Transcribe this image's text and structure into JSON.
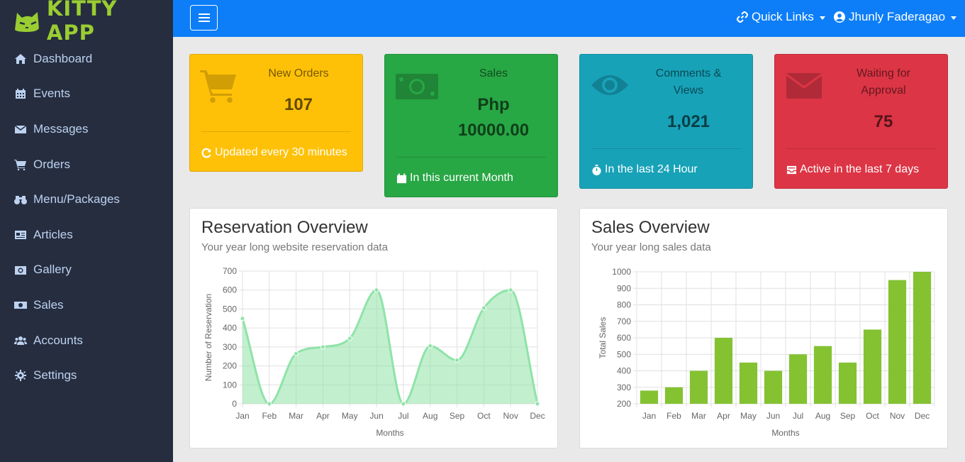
{
  "brand": {
    "name": "KITTY APP"
  },
  "sidebar": {
    "items": [
      {
        "label": "Dashboard",
        "icon": "home-icon"
      },
      {
        "label": "Events",
        "icon": "calendar-icon"
      },
      {
        "label": "Messages",
        "icon": "envelope-icon"
      },
      {
        "label": "Orders",
        "icon": "cart-icon"
      },
      {
        "label": "Menu/Packages",
        "icon": "binoculars-icon"
      },
      {
        "label": "Articles",
        "icon": "newspaper-icon"
      },
      {
        "label": "Gallery",
        "icon": "camera-icon"
      },
      {
        "label": "Sales",
        "icon": "money-bill-icon"
      },
      {
        "label": "Accounts",
        "icon": "users-icon"
      },
      {
        "label": "Settings",
        "icon": "gear-icon"
      }
    ]
  },
  "topbar": {
    "quick_links": "Quick Links",
    "user_name": "Jhunly Faderagao"
  },
  "cards": {
    "orders": {
      "label": "New Orders",
      "value": "107",
      "footer": "Updated every 30 minutes",
      "color": "#ffc107"
    },
    "sales": {
      "label": "Sales",
      "value_line1": "Php",
      "value_line2": "10000.00",
      "footer": "In this current Month",
      "color": "#28a745"
    },
    "comments": {
      "label_line1": "Comments &",
      "label_line2": "Views",
      "value": "1,021",
      "footer": "In the last 24 Hour",
      "color": "#17a2b8"
    },
    "approval": {
      "label_line1": "Waiting for",
      "label_line2": "Approval",
      "value": "75",
      "footer": "Active in the last 7 days",
      "color": "#dc3545"
    }
  },
  "reservation_panel": {
    "title": "Reservation Overview",
    "subtitle": "Your year long website reservation data"
  },
  "sales_panel": {
    "title": "Sales Overview",
    "subtitle": "Your year long sales data"
  },
  "chart_data": [
    {
      "type": "area",
      "categories": [
        "Jan",
        "Feb",
        "Mar",
        "Apr",
        "May",
        "Jun",
        "Jul",
        "Aug",
        "Sep",
        "Oct",
        "Nov",
        "Dec"
      ],
      "values": [
        450,
        0,
        265,
        300,
        345,
        600,
        0,
        305,
        230,
        505,
        600,
        0
      ],
      "xlabel": "Months",
      "ylabel": "Number of Reservation",
      "ylim": [
        0,
        700
      ],
      "yticks": [
        0,
        100,
        200,
        300,
        400,
        500,
        600,
        700
      ],
      "grid": true,
      "color": "#8fe3a8"
    },
    {
      "type": "bar",
      "categories": [
        "Jan",
        "Feb",
        "Mar",
        "Apr",
        "May",
        "Jun",
        "Jul",
        "Aug",
        "Sep",
        "Oct",
        "Nov",
        "Dec"
      ],
      "values": [
        280,
        300,
        400,
        600,
        450,
        400,
        500,
        550,
        450,
        650,
        950,
        1000
      ],
      "xlabel": "Months",
      "ylabel": "Total Sales",
      "ylim": [
        200,
        1000
      ],
      "yticks": [
        200,
        300,
        400,
        500,
        600,
        700,
        800,
        900,
        1000
      ],
      "grid": true,
      "color": "#84c232"
    }
  ]
}
